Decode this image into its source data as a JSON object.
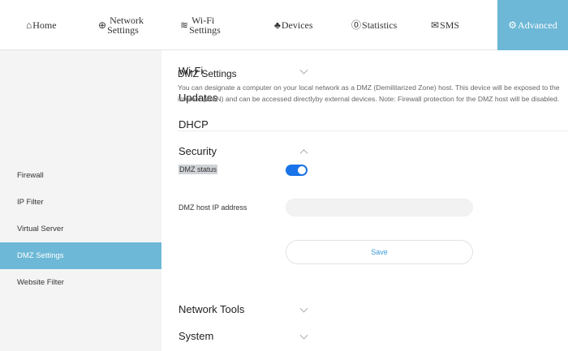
{
  "topnav": {
    "home": {
      "icon": "⌂",
      "label": "Home"
    },
    "network": {
      "icon": "⊕",
      "line1": "Network",
      "line2": "Settings"
    },
    "wifi": {
      "icon": "≋",
      "line1": "Wi-Fi",
      "line2": "Settings"
    },
    "devices": {
      "icon": "♣",
      "label": "Devices"
    },
    "statistics": {
      "icon": "⓪",
      "label": "Statistics"
    },
    "sms": {
      "icon": "✉",
      "label": "SMS"
    },
    "advanced": {
      "icon": "⚙",
      "label": "Advanced"
    }
  },
  "sidebar": {
    "items": [
      {
        "label": "Wi-Fi"
      },
      {
        "label": "Updates"
      },
      {
        "label": "DHCP"
      },
      {
        "label": "Security"
      },
      {
        "label": "Firewall"
      },
      {
        "label": "IP Filter"
      },
      {
        "label": "Virtual Server"
      },
      {
        "label": "DMZ Settings"
      },
      {
        "label": "Website Filter"
      },
      {
        "label": "Network Tools"
      },
      {
        "label": "System"
      }
    ]
  },
  "main": {
    "title": "DMZ Settings",
    "description": "You can designate a computer on your local network as a DMZ (Demilitarized Zone) host. This device will be exposed to the internet (WAN) and can be accessed directlyby external devices. Note: Firewall protection for the DMZ host will be disabled.",
    "dmz_status_label": "DMZ status",
    "dmz_status_on": true,
    "dmz_host_label": "DMZ host IP address",
    "dmz_host_value": "",
    "save_label": "Save"
  },
  "colors": {
    "accent": "#6db8d6",
    "toggle_on": "#1a73e8",
    "save_text": "#3a9ad9"
  }
}
